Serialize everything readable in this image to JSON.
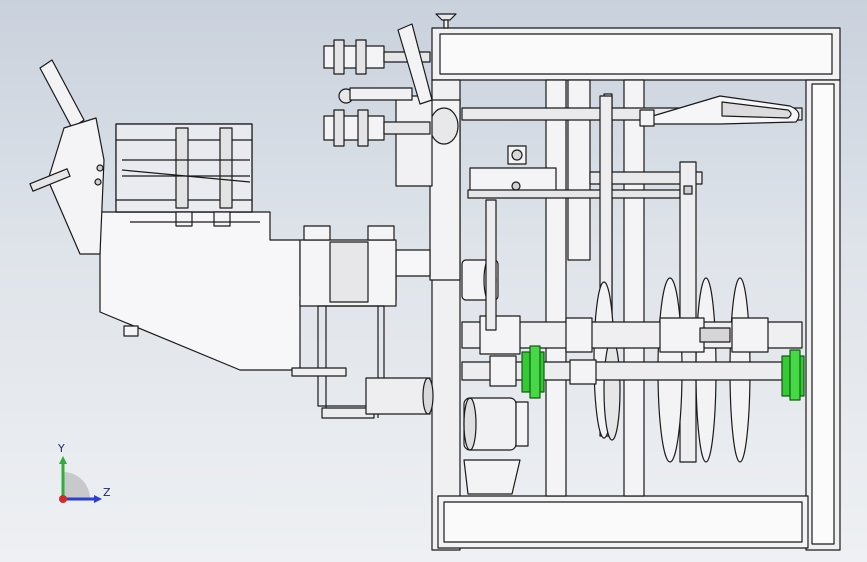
{
  "viewport": {
    "background_top": "#c9d1dc",
    "background_bottom": "#eef0f3"
  },
  "model": {
    "part_color": "#f4f4f6",
    "edge_color": "#1a1a1a",
    "shade_color": "#b9bcc2",
    "highlight_color": "#35c935"
  },
  "triad": {
    "y_label": "Y",
    "z_label": "Z",
    "y_color": "#2fae3a",
    "z_color": "#2a3fd6",
    "x_color": "#d12a2a"
  }
}
